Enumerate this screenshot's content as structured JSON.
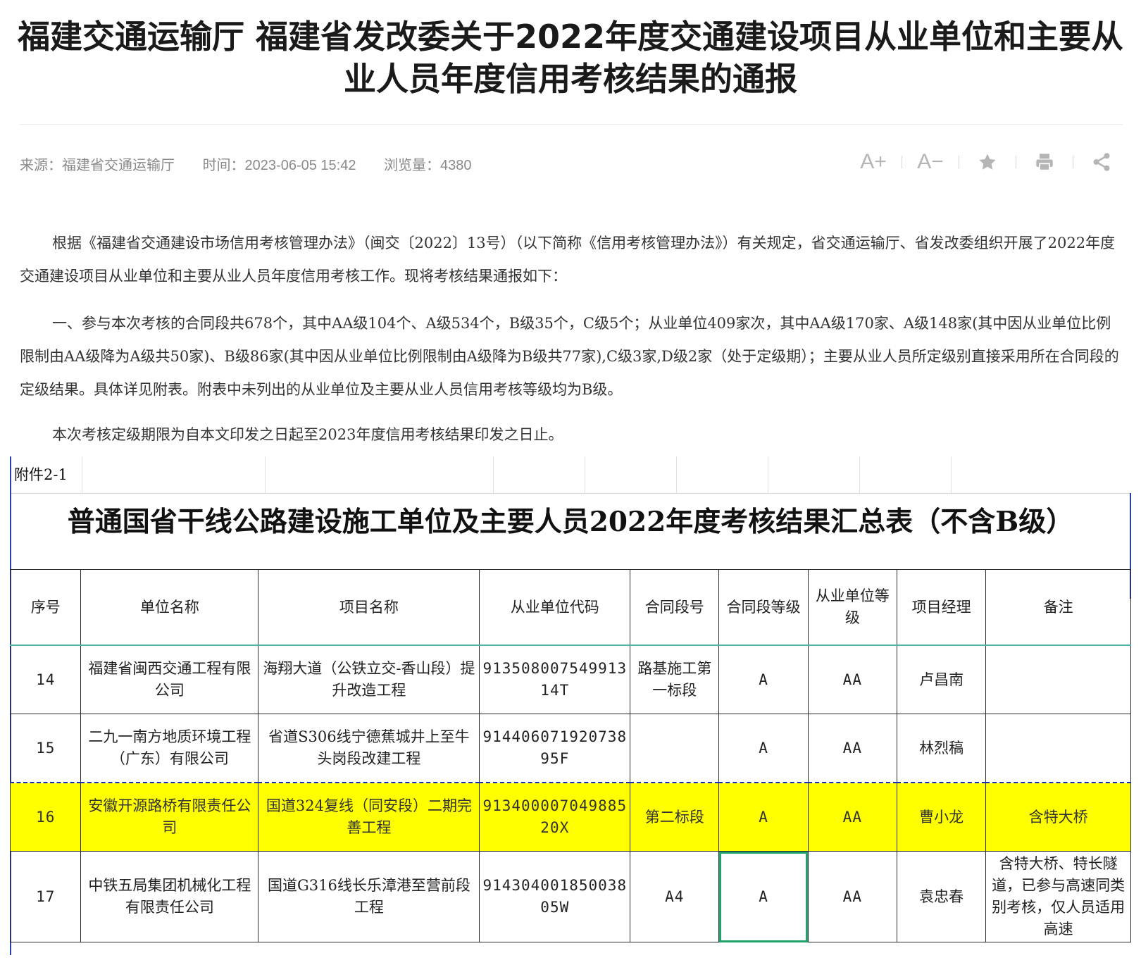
{
  "article": {
    "title": "福建交通运输厅 福建省发改委关于2022年度交通建设项目从业单位和主要从业人员年度信用考核结果的通报",
    "meta": {
      "source": "来源：福建省交通运输厅",
      "time": "时间：2023-06-05 15:42",
      "views": "浏览量：4380"
    },
    "tools": {
      "font_increase": "A+",
      "font_decrease": "A−"
    },
    "paragraphs": [
      "根据《福建省交通建设市场信用考核管理办法》（闽交〔2022〕13号）（以下简称《信用考核管理办法》）有关规定，省交通运输厅、省发改委组织开展了2022年度交通建设项目从业单位和主要从业人员年度信用考核工作。现将考核结果通报如下：",
      "一、参与本次考核的合同段共678个，其中AA级104个、A级534个，B级35个，C级5个；从业单位409家次，其中AA级170家、A级148家(其中因从业单位比例限制由AA级降为A级共50家)、B级86家(其中因从业单位比例限制由A级降为B级共77家),C级3家,D级2家（处于定级期）；主要从业人员所定级别直接采用所在合同段的定级结果。具体详见附表。附表中未列出的从业单位及主要从业人员信用考核等级均为B级。",
      "本次考核定级期限为自本文印发之日起至2023年度信用考核结果印发之日止。"
    ]
  },
  "sheet": {
    "attachment_label": "附件2-1",
    "title": "普通国省干线公路建设施工单位及主要人员2022年度考核结果汇总表（不含B级）",
    "headers": [
      "序号",
      "单位名称",
      "项目名称",
      "从业单位代码",
      "合同段号",
      "合同段等级",
      "从业单位等级",
      "项目经理",
      "备注"
    ],
    "rows": [
      {
        "no": "14",
        "company": "福建省闽西交通工程有限公司",
        "project": "海翔大道（公铁立交-香山段）提升改造工程",
        "code": "913508007549913 14T",
        "contract": "路基施工第一标段",
        "contract_grade": "A",
        "company_grade": "AA",
        "manager": "卢昌南",
        "remark": ""
      },
      {
        "no": "15",
        "company": "二九一南方地质环境工程（广东）有限公司",
        "project": "省道S306线宁德蕉城井上至牛头岗段改建工程",
        "code": "914406071920738 95F",
        "contract": "",
        "contract_grade": "A",
        "company_grade": "AA",
        "manager": "林烈稿",
        "remark": ""
      },
      {
        "no": "16",
        "company": "安徽开源路桥有限责任公司",
        "project": "国道324复线（同安段）二期完善工程",
        "code": "913400007049885 20X",
        "contract": "第二标段",
        "contract_grade": "A",
        "company_grade": "AA",
        "manager": "曹小龙",
        "remark": "含特大桥",
        "highlight": "#ffff00"
      },
      {
        "no": "17",
        "company": "中铁五局集团机械化工程有限责任公司",
        "project": "国道G316线长乐漳港至营前段工程",
        "code": "914304001850038 05W",
        "contract": "A4",
        "contract_grade": "A",
        "company_grade": "AA",
        "manager": "袁忠春",
        "remark": "含特大桥、特长隧道，已参与高速同类别考核，仅人员适用高速"
      }
    ]
  },
  "colors": {
    "highlight_row": "#ffff00",
    "sheet_border": "#2a3fa8",
    "selection": "#1fa36b"
  }
}
